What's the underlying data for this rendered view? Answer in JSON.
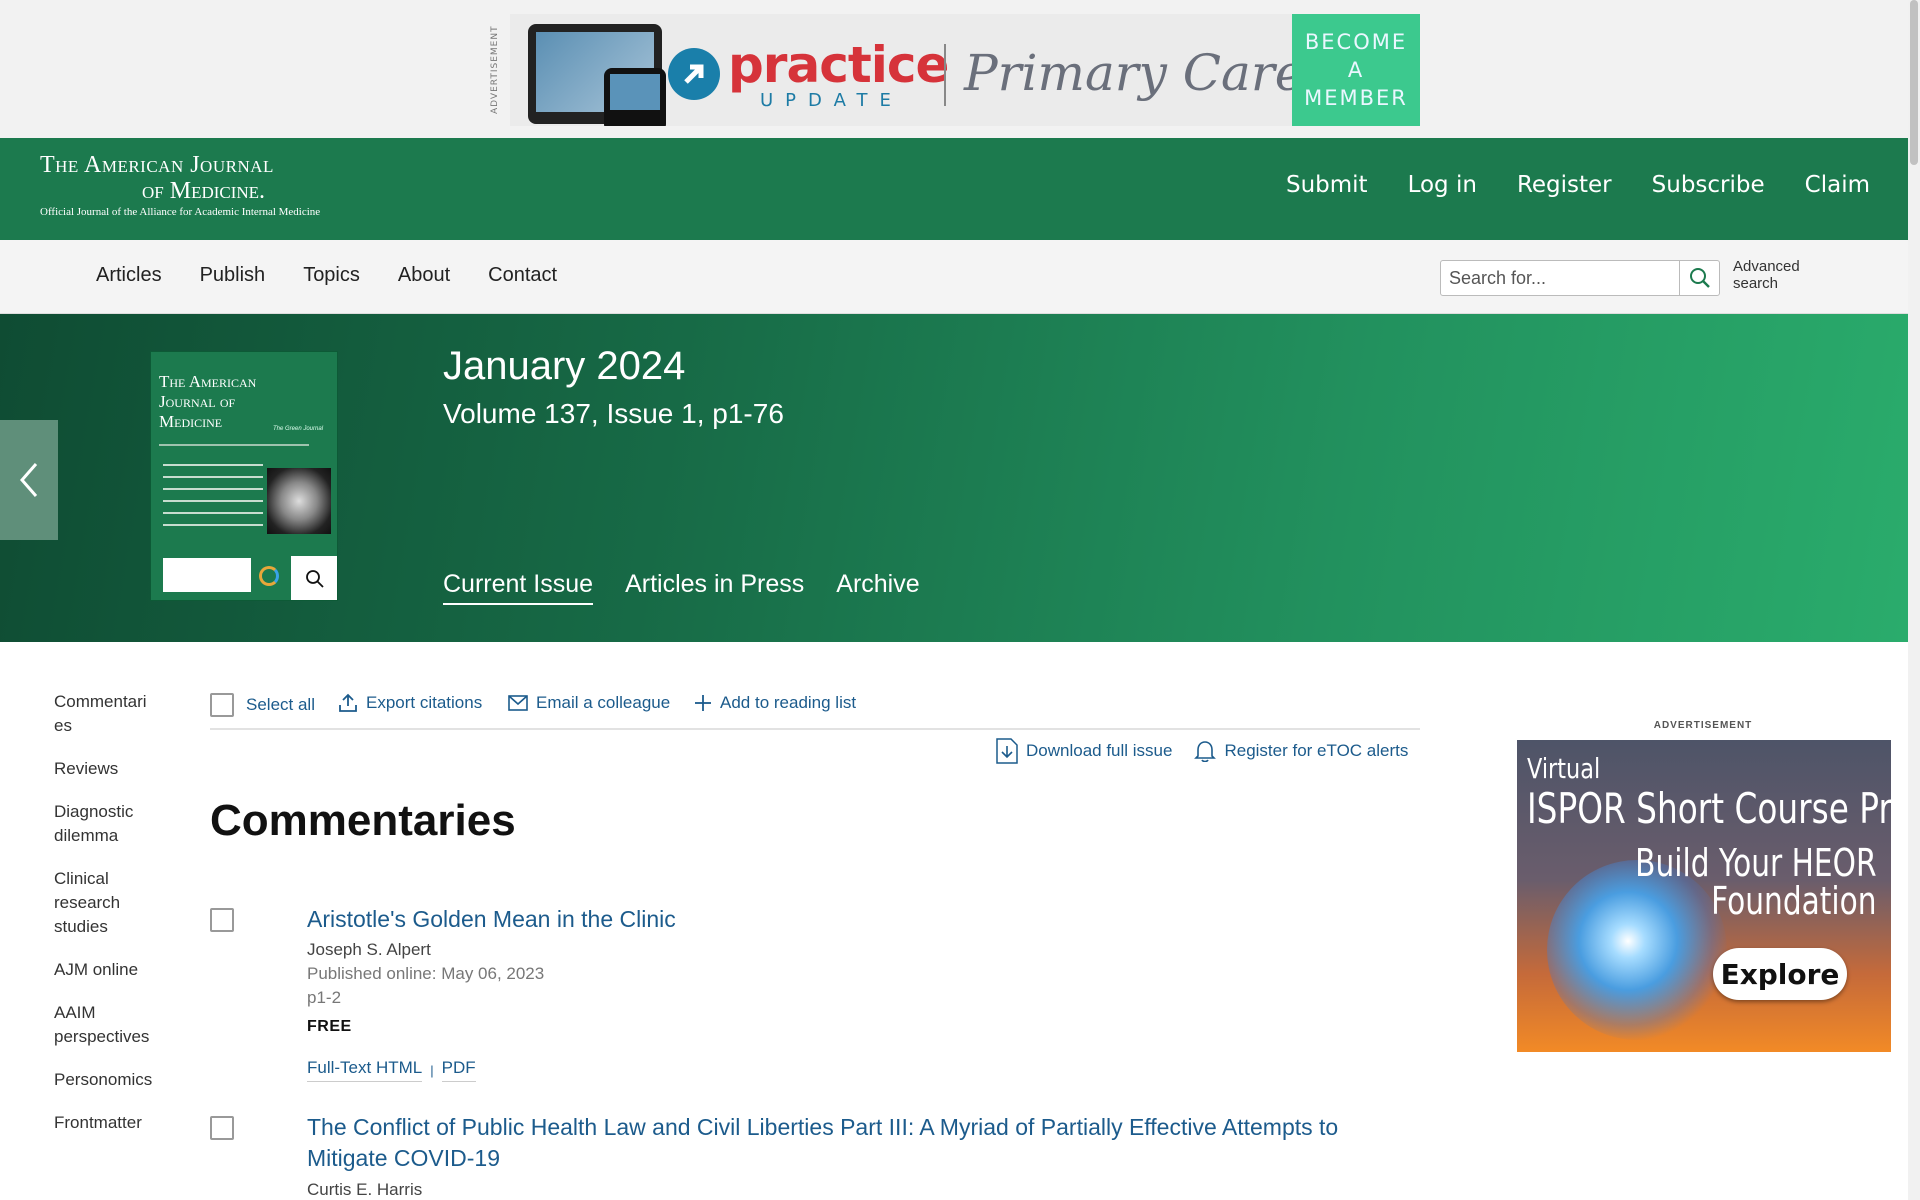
{
  "top_ad": {
    "label": "ADVERTISEMENT",
    "brand_main": "practice",
    "brand_sub": "UPDATE",
    "tagline": "Primary Care",
    "cta": "BECOME A MEMBER",
    "colors": {
      "brand": "#d6333a",
      "cta_bg": "#3cc98e"
    }
  },
  "journal": {
    "name_line1": "The American Journal",
    "name_line2": "of Medicine.",
    "subtitle": "Official Journal of the Alliance for Academic Internal Medicine",
    "header_links": [
      "Submit",
      "Log in",
      "Register",
      "Subscribe",
      "Claim"
    ],
    "colors": {
      "header_bg": "#1c7a4e"
    }
  },
  "nav": {
    "items": [
      "Articles",
      "Publish",
      "Topics",
      "About",
      "Contact"
    ],
    "search_placeholder": "Search for...",
    "advanced_search": "Advanced search",
    "icons": {
      "search": "search-icon"
    }
  },
  "issue": {
    "month": "January 2024",
    "volume": "Volume 137, Issue 1, p1-76",
    "tabs": [
      "Current Issue",
      "Articles in Press",
      "Archive"
    ],
    "active_tab": "Current Issue",
    "cover_title": "The American Journal of Medicine",
    "cover_tagline": "The Green Journal"
  },
  "side_nav": [
    "Commentaries",
    "Reviews",
    "Diagnostic dilemma",
    "Clinical research studies",
    "AJM online",
    "AAIM perspectives",
    "Personomics",
    "Frontmatter"
  ],
  "toolbar": {
    "select_all": "Select all",
    "export": "Export citations",
    "email": "Email a colleague",
    "reading_list": "Add to reading list",
    "download": "Download full issue",
    "etoc": "Register for eTOC alerts"
  },
  "section_title": "Commentaries",
  "articles": [
    {
      "title": "Aristotle's Golden Mean in the Clinic",
      "author": "Joseph S. Alpert",
      "published": "Published online: May 06, 2023",
      "pages": "p1-2",
      "access": "FREE",
      "links": [
        "Full-Text HTML",
        "PDF"
      ]
    },
    {
      "title": "The Conflict of Public Health Law and Civil Liberties Part III: A Myriad of Partially Effective Attempts to Mitigate COVID-19",
      "author": "Curtis E. Harris"
    }
  ],
  "right_ad": {
    "label": "ADVERTISEMENT",
    "line1": "Virtual",
    "line2": "ISPOR Short Course Program",
    "line3": "Build Your HEOR",
    "line4": "Foundation",
    "cta": "Explore"
  }
}
